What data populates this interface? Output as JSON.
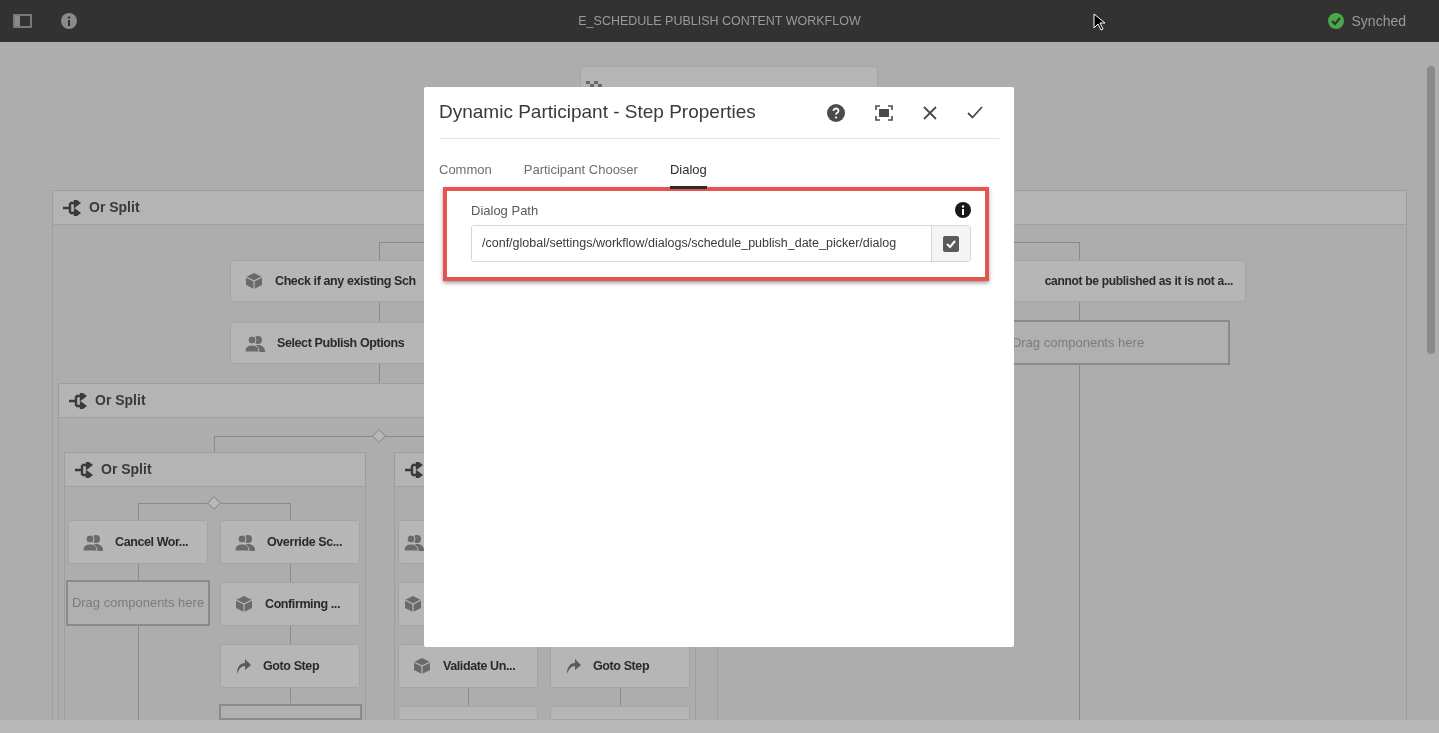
{
  "header": {
    "title": "E_SCHEDULE PUBLISH CONTENT WORKFLOW",
    "status": "Synched"
  },
  "splits": [
    {
      "kind": "or",
      "label": "Or Split"
    },
    {
      "kind": "or",
      "label": "Or Split"
    },
    {
      "kind": "or",
      "label": "Or Split"
    },
    {
      "kind": "or"
    }
  ],
  "nodes": [
    {
      "kind": "start"
    },
    {
      "kind": "process",
      "label": "Check if any existing Sch"
    },
    {
      "kind": "text-only",
      "label": "cannot be published as it is not a..."
    },
    {
      "kind": "participant",
      "label": "Select Publish Options"
    },
    {
      "kind": "dropzone",
      "label": "Drag components here"
    },
    {
      "kind": "participant",
      "label": "Cancel Wor..."
    },
    {
      "kind": "participant",
      "label": "Override Sc..."
    },
    {
      "kind": "dropzone",
      "label": "Drag components here"
    },
    {
      "kind": "process",
      "label": "Confirming ..."
    },
    {
      "kind": "goto",
      "label": "Goto Step"
    },
    {
      "kind": "participant"
    },
    {
      "kind": "process"
    },
    {
      "kind": "process",
      "label": "Validate Un..."
    },
    {
      "kind": "goto",
      "label": "Goto Step"
    },
    {
      "kind": "dropzone"
    },
    {
      "kind": "empty"
    },
    {
      "kind": "empty"
    }
  ],
  "dialog": {
    "title": "Dynamic Participant - Step Properties",
    "tabs": [
      {
        "label": "Common",
        "selected": false
      },
      {
        "label": "Participant Chooser",
        "selected": false
      },
      {
        "label": "Dialog",
        "selected": true
      }
    ],
    "field": {
      "label": "Dialog Path",
      "value": "/conf/global/settings/workflow/dialogs/schedule_publish_date_picker/dialog",
      "highlighted": true
    }
  }
}
